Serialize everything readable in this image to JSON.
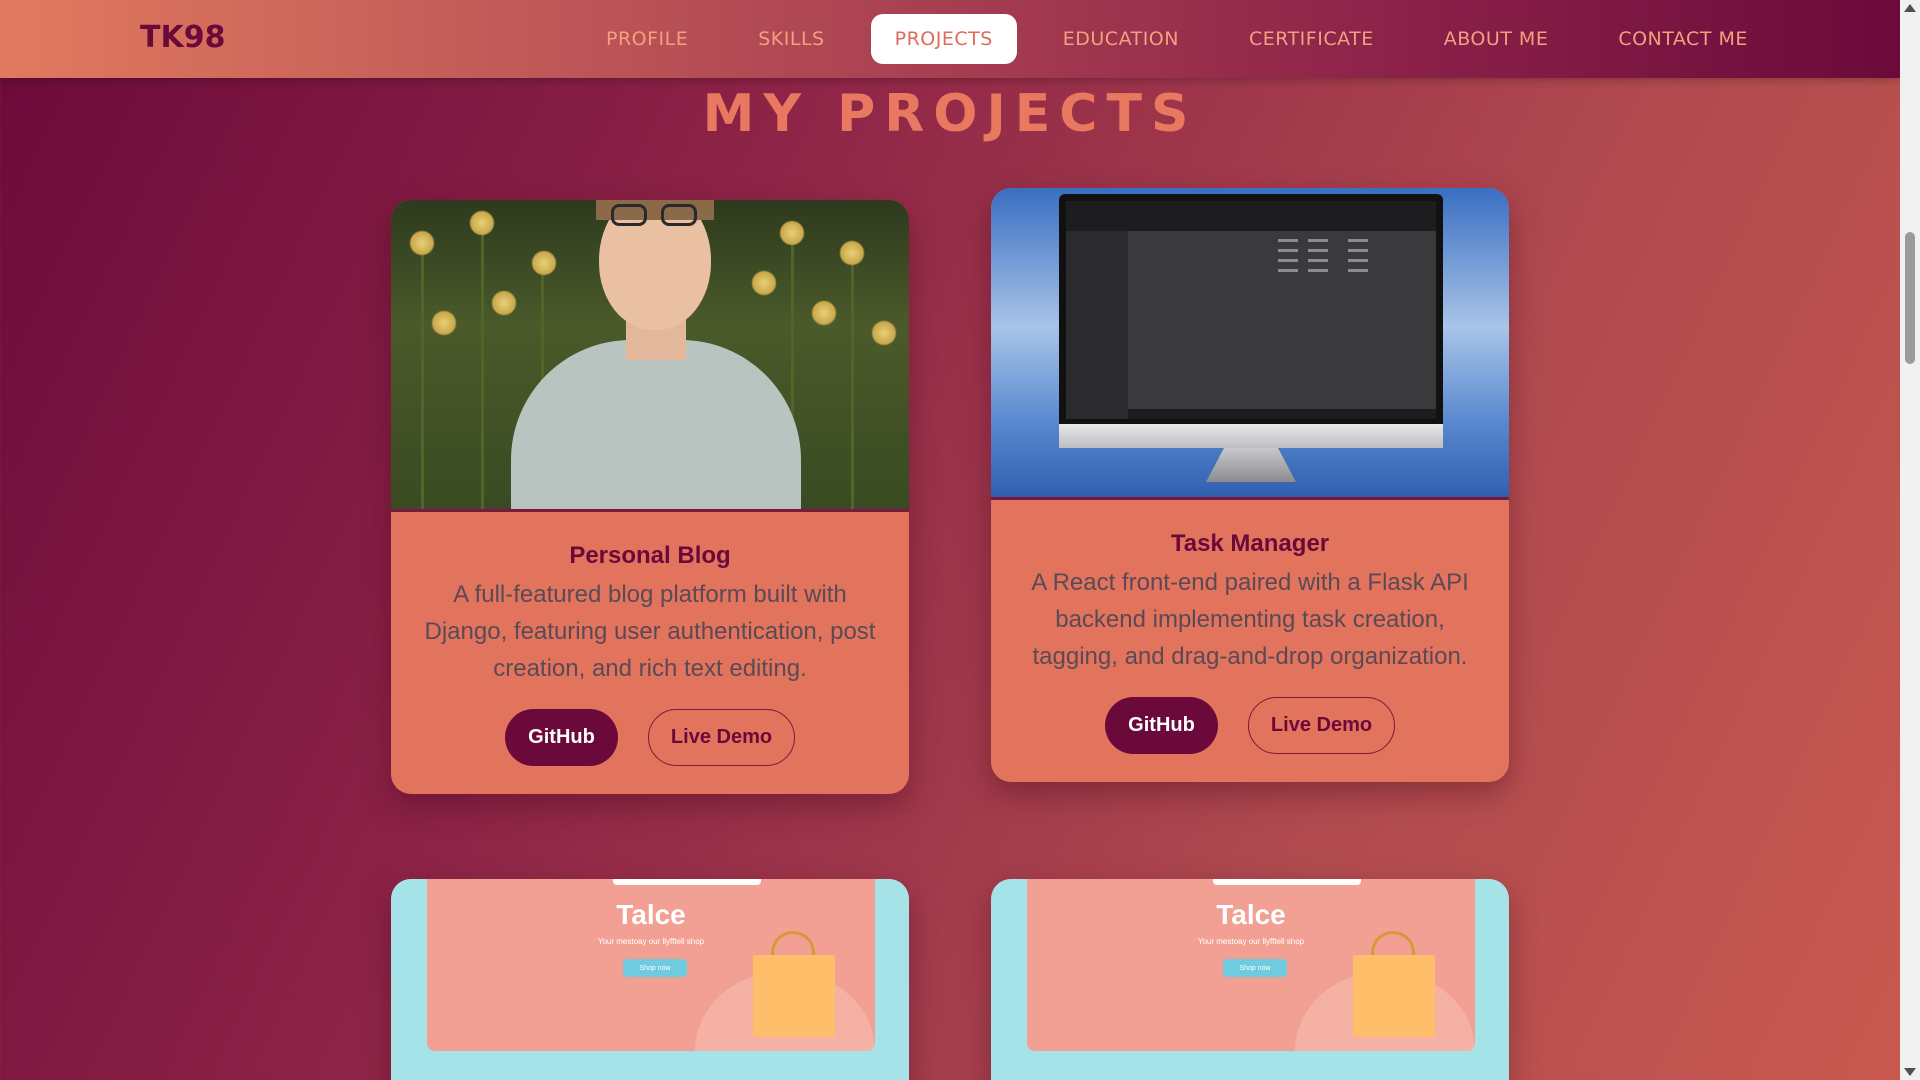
{
  "nav": {
    "brand": "TK98",
    "items": [
      {
        "label": "PROFILE",
        "active": false
      },
      {
        "label": "SKILLS",
        "active": false
      },
      {
        "label": "PROJECTS",
        "active": true
      },
      {
        "label": "EDUCATION",
        "active": false
      },
      {
        "label": "CERTIFICATE",
        "active": false
      },
      {
        "label": "ABOUT ME",
        "active": false
      },
      {
        "label": "CONTACT ME",
        "active": false
      }
    ]
  },
  "page": {
    "title": "MY PROJECTS"
  },
  "projects": [
    {
      "title": "Personal Blog",
      "description": "A full-featured blog platform built with Django, featuring user authentication, post creation, and rich text editing.",
      "github_label": "GitHub",
      "demo_label": "Live Demo",
      "image": "portrait-photo"
    },
    {
      "title": "Task Manager",
      "description": "A React front-end paired with a Flask API backend implementing task creation, tagging, and drag-and-drop organization.",
      "github_label": "GitHub",
      "demo_label": "Live Demo",
      "image": "monitor-screenshot"
    },
    {
      "image": "shop-banner",
      "shop_title": "Talce",
      "shop_subtitle": "Your mestoay our llyfftell shop",
      "shop_button": "Shop now"
    },
    {
      "image": "shop-banner",
      "shop_title": "Talce",
      "shop_subtitle": "Your mestoay our llyfftell shop",
      "shop_button": "Shop now"
    }
  ],
  "colors": {
    "accent": "#e8785f",
    "dark": "#6b0a3a",
    "card": "#e2735c"
  }
}
